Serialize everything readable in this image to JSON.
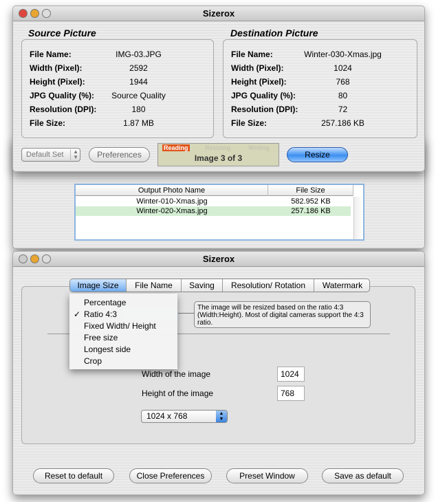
{
  "main_window": {
    "title": "Sizerox",
    "source": {
      "title": "Source Picture",
      "rows": [
        {
          "label": "File Name:",
          "value": "IMG-03.JPG"
        },
        {
          "label": "Width (Pixel):",
          "value": "2592"
        },
        {
          "label": "Height (Pixel):",
          "value": "1944"
        },
        {
          "label": "JPG Quality (%):",
          "value": "Source Quality"
        },
        {
          "label": "Resolution (DPI):",
          "value": "180"
        },
        {
          "label": "File Size:",
          "value": "1.87 MB"
        }
      ]
    },
    "destination": {
      "title": "Destination Picture",
      "rows": [
        {
          "label": "File Name:",
          "value": "Winter-030-Xmas.jpg"
        },
        {
          "label": "Width (Pixel):",
          "value": "1024"
        },
        {
          "label": "Height (Pixel):",
          "value": "768"
        },
        {
          "label": "JPG Quality (%):",
          "value": "80"
        },
        {
          "label": "Resolution (DPI):",
          "value": "72"
        },
        {
          "label": "File Size:",
          "value": "257.186 KB"
        }
      ]
    },
    "preset_select": "Default Set",
    "preferences_label": "Preferences",
    "progress": {
      "stages": [
        "Reading",
        "Resizing",
        "Writing"
      ],
      "active_stage": "Reading",
      "status": "Image 3 of 3",
      "active_color": "#e0561c"
    },
    "resize_label": "Resize"
  },
  "output_list": {
    "columns": [
      "Output Photo Name",
      "File Size"
    ],
    "rows": [
      {
        "name": "Winter-010-Xmas.jpg",
        "size": "582.952 KB"
      },
      {
        "name": "Winter-020-Xmas.jpg",
        "size": "257.186 KB"
      }
    ]
  },
  "prefs_window": {
    "title": "Sizerox",
    "tabs": [
      "Image Size",
      "File Name",
      "Saving",
      "Resolution/ Rotation",
      "Watermark"
    ],
    "menu": {
      "items": [
        "Percentage",
        "Ratio 4:3",
        "Fixed Width/ Height",
        "Free size",
        "Longest side",
        "Crop"
      ],
      "checked": "Ratio 4:3",
      "check": "✓"
    },
    "info": "The image will be resized based on the ratio 4:3 (Width:Height). Most of digital cameras support the 4:3 ratio.",
    "width_label": "Width of the image",
    "width_value": "1024",
    "height_label": "Height of the image",
    "height_value": "768",
    "size_select": "1024 x 768",
    "buttons": [
      "Reset to default",
      "Close Preferences",
      "Preset Window",
      "Save as default"
    ]
  }
}
